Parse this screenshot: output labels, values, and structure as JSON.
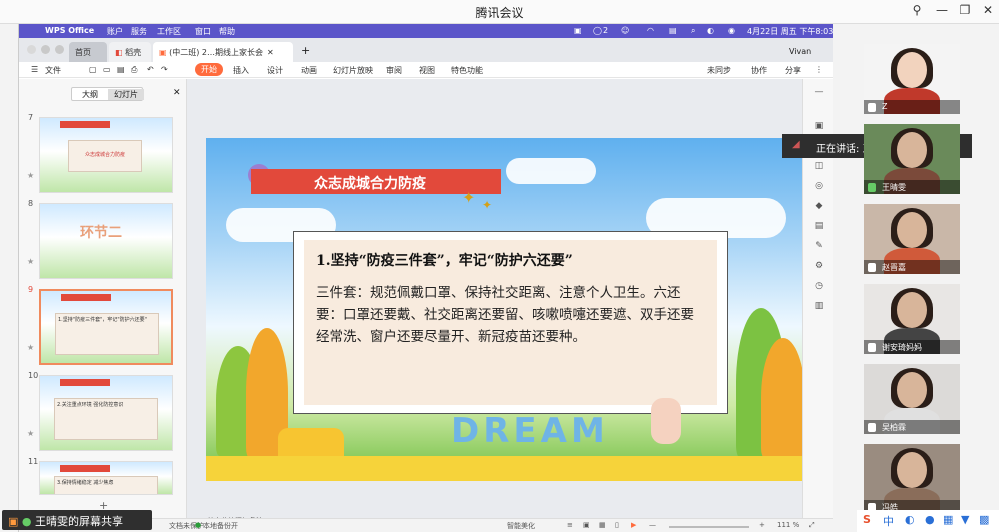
{
  "window": {
    "title": "腾讯会议"
  },
  "macbar": {
    "app": "WPS Office",
    "menus": [
      "账户",
      "服务",
      "工作区",
      "窗口",
      "帮助"
    ],
    "notif_count": "2",
    "clock": "4月22日 周五 下午8:03"
  },
  "tabs": [
    {
      "label": "首页"
    },
    {
      "label": "稻壳"
    },
    {
      "label": "(中二班) 2…期线上家长会"
    }
  ],
  "user": "Vivan",
  "menubar": {
    "file": "文件",
    "items": [
      "开始",
      "插入",
      "设计",
      "动画",
      "幻灯片放映",
      "审阅",
      "视图",
      "特色功能"
    ],
    "sync": "未同步",
    "collab": "协作",
    "share": "分享"
  },
  "panel": {
    "tab_outline": "大纲",
    "tab_slides": "幻灯片",
    "add": "+"
  },
  "thumbs": [
    {
      "num": "7",
      "caption": "众志成城合力防疫"
    },
    {
      "num": "8",
      "caption": "环节二"
    },
    {
      "num": "9",
      "caption": "1.坚持\"防疫三件套\"，牢记\"防护六还要\""
    },
    {
      "num": "10",
      "caption": "2.关注重点环境 强化防控意识"
    },
    {
      "num": "11",
      "caption": "3.保持情绪稳定 减少焦虑"
    }
  ],
  "slide": {
    "banner": "众志成城合力防疫",
    "heading": "1.坚持“防疫三件套”，牢记“防护六还要”",
    "body": "三件套：规范佩戴口罩、保持社交距离、注意个人卫生。六还要：口罩还要戴、社交距离还要留、咳嗽喷嚏还要遮、双手还要经常洗、窗户还要尽量开、新冠疫苗还要种。",
    "dream": "DREAM"
  },
  "note_hint": "单击此处添加备注",
  "status": {
    "doc_protect": "文档未保护",
    "local_backup": "本地备份开",
    "beautify": "智能美化",
    "zoom": "111 %"
  },
  "sharer": "王晴雯的屏幕共享",
  "speaking": "正在讲话: 王晴雯; sharry;",
  "participants": [
    {
      "name": "Z",
      "shirt": "#c0392b"
    },
    {
      "name": "王晴雯",
      "shirt": "#7b4a3a"
    },
    {
      "name": "赵晋嘉",
      "shirt": "#d05a3a"
    },
    {
      "name": "谢安琦妈妈",
      "shirt": "#444"
    },
    {
      "name": "吴柏霖",
      "shirt": "#e0e0e0"
    },
    {
      "name": "冯皓",
      "shirt": "#8a6d5a"
    }
  ],
  "ime": {
    "label": "中"
  }
}
